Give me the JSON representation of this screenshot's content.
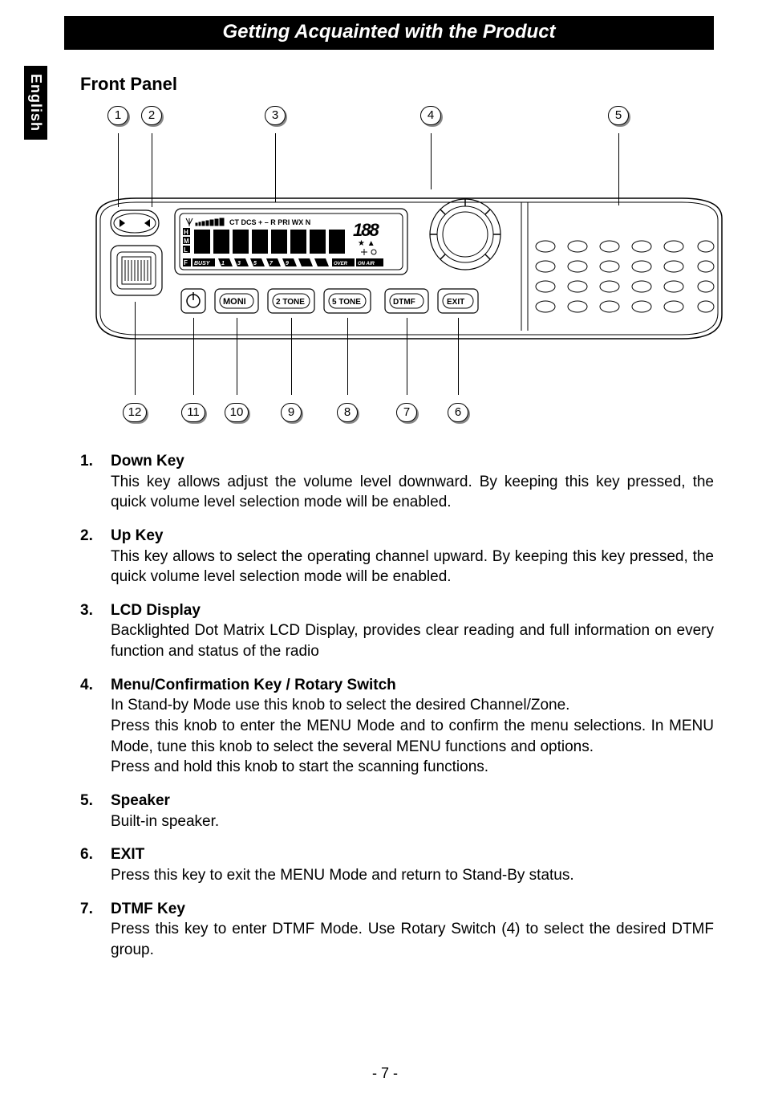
{
  "header": {
    "title": "Getting Acquainted with the Product"
  },
  "sideTab": "English",
  "sectionTitle": "Front Panel",
  "diagram": {
    "topCallouts": [
      "1",
      "2",
      "3",
      "4",
      "5"
    ],
    "bottomCallouts": [
      "12",
      "11",
      "10",
      "9",
      "8",
      "7",
      "6"
    ],
    "lcdTop": "CT DCS + – R PRI WX N",
    "lcdLeft": {
      "h": "H",
      "m": "M",
      "l": "L"
    },
    "lcdBottomF": "F",
    "lcdBusy": "BUSY",
    "lcdNums": [
      "1",
      "3",
      "5",
      "7",
      "9"
    ],
    "lcdOver": "OVER",
    "lcdOnAir": "ON AIR",
    "lcd188": "188",
    "buttons": {
      "moni": "MONI",
      "tone2": "2 TONE",
      "tone5": "5 TONE",
      "dtmf": "DTMF",
      "exit": "EXIT"
    }
  },
  "items": [
    {
      "num": "1.",
      "title": "Down Key",
      "text": "This key allows adjust the volume level downward. By keeping this key pressed, the quick volume level selection mode will be enabled."
    },
    {
      "num": "2.",
      "title": "Up Key",
      "text": "This key allows to select the operating channel upward. By keeping this key pressed, the quick volume level selection mode will be enabled."
    },
    {
      "num": "3.",
      "title": "LCD Display",
      "text": "Backlighted Dot Matrix LCD Display, provides clear reading and full information on every function and status of the radio"
    },
    {
      "num": "4.",
      "title": "Menu/Confirmation Key / Rotary Switch",
      "text": "In Stand-by Mode use this knob to select the desired Channel/Zone.\nPress this knob to enter the MENU Mode and to confirm the menu selections. In MENU Mode, tune this knob to select the several MENU functions and options.\nPress and hold this knob to start the scanning functions."
    },
    {
      "num": "5.",
      "title": "Speaker",
      "text": "Built-in speaker."
    },
    {
      "num": "6.",
      "title": "EXIT",
      "text": "Press this key to exit the MENU Mode and return to Stand-By status."
    },
    {
      "num": "7.",
      "title": "DTMF Key",
      "text": "Press this key to enter DTMF Mode. Use Rotary Switch (4) to select the desired DTMF group."
    }
  ],
  "pageNumber": "- 7 -"
}
